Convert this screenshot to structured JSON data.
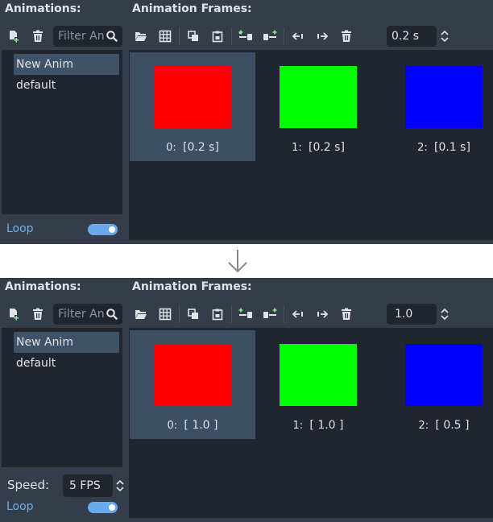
{
  "top": {
    "animations_header": "Animations:",
    "frames_header": "Animation Frames:",
    "filter_placeholder": "Filter Animations",
    "animations": [
      {
        "label": "New Anim",
        "selected": true
      },
      {
        "label": "default",
        "selected": false
      }
    ],
    "duration_value": "0.2 s",
    "frames": [
      {
        "index": "0:",
        "duration": "[0.2 s]",
        "color": "#ff0000",
        "selected": true
      },
      {
        "index": "1:",
        "duration": "[0.2 s]",
        "color": "#00ff00",
        "selected": false
      },
      {
        "index": "2:",
        "duration": "[0.1 s]",
        "color": "#0000ff",
        "selected": false
      }
    ],
    "loop_label": "Loop"
  },
  "bottom": {
    "animations_header": "Animations:",
    "frames_header": "Animation Frames:",
    "filter_placeholder": "Filter Animations",
    "animations": [
      {
        "label": "New Anim",
        "selected": true
      },
      {
        "label": "default",
        "selected": false
      }
    ],
    "duration_value": "1.0",
    "frames": [
      {
        "index": "0:",
        "duration": "[ 1.0 ]",
        "color": "#ff0000",
        "selected": true
      },
      {
        "index": "1:",
        "duration": "[ 1.0 ]",
        "color": "#00ff00",
        "selected": false
      },
      {
        "index": "2:",
        "duration": "[ 0.5 ]",
        "color": "#0000ff",
        "selected": false
      }
    ],
    "speed_label": "Speed:",
    "speed_value": "5 FPS",
    "loop_label": "Loop"
  },
  "icons": [
    "new-animation-icon",
    "delete-icon",
    "search-icon",
    "open-folder-icon",
    "grid-icon",
    "copy-icon",
    "paste-icon",
    "insert-before-icon",
    "insert-after-icon",
    "move-left-icon",
    "move-right-icon",
    "delete-frame-icon",
    "spin-arrows-icon",
    "down-arrow-icon"
  ],
  "colors": {
    "panel": "#363d4a",
    "list_bg": "#21262e",
    "selection": "#3f5268",
    "accent": "#69b0f0",
    "text": "#dfe2e7"
  }
}
